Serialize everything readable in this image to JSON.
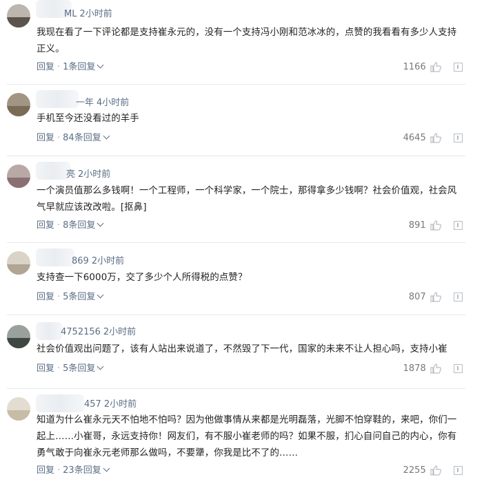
{
  "reply_label": "回复",
  "comments": [
    {
      "name_tail": "ML",
      "time": "2小时前",
      "text": "我现在看了一下评论都是支持崔永元的，没有一个支持冯小刚和范冰冰的，点赞的我看看有多少人支持正义。",
      "replies": "1条回复",
      "likes": "1166"
    },
    {
      "name_tail": "一年",
      "time": "4小时前",
      "text": "手机至今还没看过的羊手",
      "replies": "84条回复",
      "likes": "4645"
    },
    {
      "name_tail": "亮",
      "time": "2小时前",
      "text": "一个演员值那么多钱啊！一个工程师，一个科学家，一个院士，那得拿多少钱啊？社会价值观，社会风气早就应该改改啦。[抠鼻]",
      "replies": "8条回复",
      "likes": "891"
    },
    {
      "name_tail": "869",
      "time": "2小时前",
      "text": "支持查一下6000万，交了多少个人所得税的点赞？",
      "replies": "5条回复",
      "likes": "807"
    },
    {
      "name_tail": "4752156",
      "time": "2小时前",
      "text": "社会价值观出问题了，该有人站出来说道了，不然毁了下一代，国家的未来不让人担心吗，支持小崔",
      "replies": "5条回复",
      "likes": "1878"
    },
    {
      "name_tail": "457",
      "time": "2小时前",
      "text": "知道为什么崔永元天不怕地不怕吗？因为他做事情从来都是光明磊落，光脚不怕穿鞋的，来吧，你们一起上……小崔哥，永远支持你！网友们，有不服小崔老师的吗？如果不服，扪心自问自己的内心，你有勇气敢于向崔永元老师那么做吗，不要犟，你我是比不了的……",
      "replies": "23条回复",
      "likes": "2255"
    }
  ]
}
